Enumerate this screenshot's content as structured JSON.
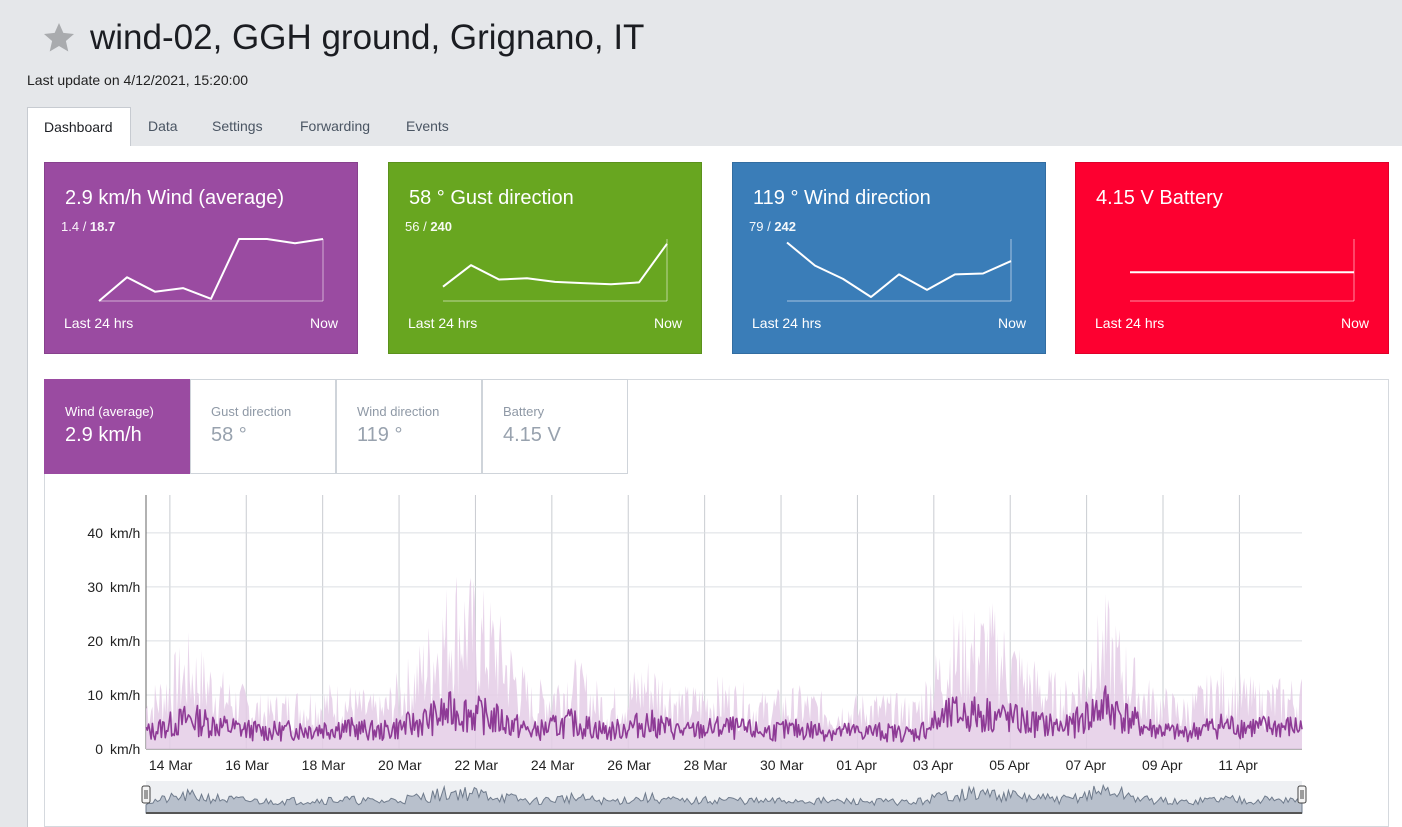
{
  "header": {
    "title": "wind-02, GGH ground, Grignano, IT",
    "last_update": "Last update on 4/12/2021, 15:20:00"
  },
  "tabs": [
    {
      "label": "Dashboard",
      "active": true
    },
    {
      "label": "Data"
    },
    {
      "label": "Settings"
    },
    {
      "label": "Forwarding"
    },
    {
      "label": "Events"
    }
  ],
  "cards": [
    {
      "title": "2.9 km/h Wind (average)",
      "min": "1.4",
      "max": "18.7",
      "color": "#9a4ba1",
      "from": "Last 24 hrs",
      "to": "Now",
      "spark": [
        1.4,
        8,
        4,
        5,
        2,
        18.7,
        18.7,
        17.5,
        18.7
      ],
      "spark_range": [
        1.4,
        18.7
      ]
    },
    {
      "title": "58 ° Gust direction",
      "min": "56",
      "max": "240",
      "color": "#68a620",
      "from": "Last 24 hrs",
      "to": "Now",
      "spark": [
        60,
        150,
        90,
        95,
        80,
        75,
        70,
        78,
        240
      ],
      "spark_range": [
        0,
        260
      ]
    },
    {
      "title": "119 ° Wind direction",
      "min": "79",
      "max": "242",
      "color": "#3a7db8",
      "from": "Last 24 hrs",
      "to": "Now",
      "spark": [
        242,
        190,
        160,
        119,
        170,
        135,
        170,
        172,
        200
      ],
      "spark_range": [
        110,
        250
      ]
    },
    {
      "title": "4.15 V Battery",
      "min": "",
      "max": "",
      "color": "#fd0030",
      "from": "Last 24 hrs",
      "to": "Now",
      "spark": [
        4.15,
        4.15,
        4.15,
        4.15,
        4.15,
        4.15,
        4.15,
        4.15,
        4.15
      ],
      "spark_range": [
        3.5,
        4.9
      ]
    }
  ],
  "metric_tabs": [
    {
      "label": "Wind (average)",
      "value": "2.9 km/h",
      "active": true
    },
    {
      "label": "Gust direction",
      "value": "58 °"
    },
    {
      "label": "Wind direction",
      "value": "119 °"
    },
    {
      "label": "Battery",
      "value": "4.15 V"
    }
  ],
  "chart_data": {
    "type": "area",
    "y_unit": "km/h",
    "ylim": [
      0,
      47
    ],
    "yticks": [
      0,
      10,
      20,
      30,
      40
    ],
    "x_tick_labels": [
      "14 Mar",
      "16 Mar",
      "18 Mar",
      "20 Mar",
      "22 Mar",
      "24 Mar",
      "26 Mar",
      "28 Mar",
      "30 Mar",
      "01 Apr",
      "03 Apr",
      "05 Apr",
      "07 Apr",
      "09 Apr",
      "11 Apr"
    ],
    "x_range": [
      "2021-03-13 09:00",
      "2021-04-12 15:20"
    ],
    "grid": true,
    "series": [
      {
        "color": "#e4cde6",
        "x": [
          "2021-03-13",
          "2021-03-14",
          "2021-03-15",
          "2021-03-16",
          "2021-03-17",
          "2021-03-18",
          "2021-03-19",
          "2021-03-20",
          "2021-03-21",
          "2021-03-22",
          "2021-03-23",
          "2021-03-24",
          "2021-03-25",
          "2021-03-26",
          "2021-03-27",
          "2021-03-28",
          "2021-03-29",
          "2021-03-30",
          "2021-03-31",
          "2021-04-01",
          "2021-04-02",
          "2021-04-03",
          "2021-04-04",
          "2021-04-05",
          "2021-04-06",
          "2021-04-07",
          "2021-04-08",
          "2021-04-09",
          "2021-04-10",
          "2021-04-11",
          "2021-04-12"
        ],
        "y": [
          12,
          22,
          14,
          10,
          12,
          13,
          10,
          20,
          36,
          28,
          12,
          18,
          11,
          18,
          12,
          14,
          11,
          12,
          10,
          11,
          10,
          26,
          28,
          18,
          13,
          29,
          14,
          10,
          16,
          13,
          14
        ]
      },
      {
        "color": "#8e3b96",
        "x": [
          "2021-03-13",
          "2021-03-14",
          "2021-03-15",
          "2021-03-16",
          "2021-03-17",
          "2021-03-18",
          "2021-03-19",
          "2021-03-20",
          "2021-03-21",
          "2021-03-22",
          "2021-03-23",
          "2021-03-24",
          "2021-03-25",
          "2021-03-26",
          "2021-03-27",
          "2021-03-28",
          "2021-03-29",
          "2021-03-30",
          "2021-03-31",
          "2021-04-01",
          "2021-04-02",
          "2021-04-03",
          "2021-04-04",
          "2021-04-05",
          "2021-04-06",
          "2021-04-07",
          "2021-04-08",
          "2021-04-09",
          "2021-04-10",
          "2021-04-11",
          "2021-04-12"
        ],
        "y": [
          4,
          7,
          5,
          4,
          4.5,
          5,
          4,
          6,
          9,
          7,
          4,
          6,
          4,
          6,
          4,
          5,
          4,
          4.5,
          4,
          4,
          3.5,
          8,
          8,
          6,
          5,
          10,
          5,
          3.5,
          5.5,
          5,
          5
        ]
      }
    ]
  }
}
